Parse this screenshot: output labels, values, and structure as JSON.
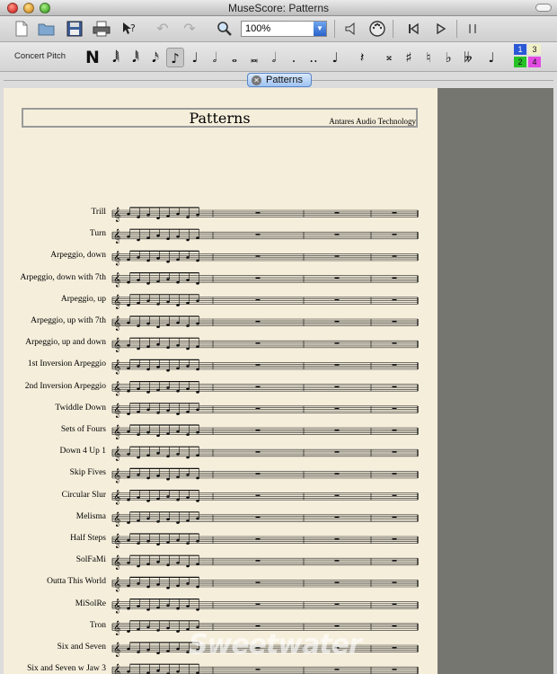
{
  "window": {
    "title": "MuseScore: Patterns"
  },
  "toolbar": {
    "zoom_value": "100%",
    "icons": [
      "new-file-icon",
      "open-file-icon",
      "save-icon",
      "print-icon",
      "whats-this-icon",
      "undo-icon",
      "redo-icon",
      "zoom-icon",
      "speaker-icon",
      "midi-input-icon",
      "rewind-icon",
      "play-icon",
      "pause-icon"
    ]
  },
  "notebar": {
    "concert_pitch": "Concert Pitch",
    "note_input": "N",
    "voices": [
      "1",
      "3",
      "2",
      "4"
    ]
  },
  "tab": {
    "label": "Patterns"
  },
  "score": {
    "title": "Patterns",
    "composer": "Antares Audio Technology",
    "staves": [
      "Trill",
      "Turn",
      "Arpeggio, down",
      "Arpeggio, down with 7th",
      "Arpeggio, up",
      "Arpeggio, up with 7th",
      "Arpeggio, up and down",
      "1st Inversion Arpeggio",
      "2nd Inversion Arpeggio",
      "Twiddle Down",
      "Sets of Fours",
      "Down 4 Up 1",
      "Skip Fives",
      "Circular Slur",
      "Melisma",
      "Half Steps",
      "SolFaMi",
      "Outta This World",
      "MiSolRe",
      "Tron",
      "Six and Seven",
      "Six and Seven w Jaw 3"
    ]
  },
  "watermark": "Sweetwater",
  "colors": {
    "paper": "#f5eedb",
    "canvas": "#767670",
    "tab": "#9fc3f2"
  }
}
